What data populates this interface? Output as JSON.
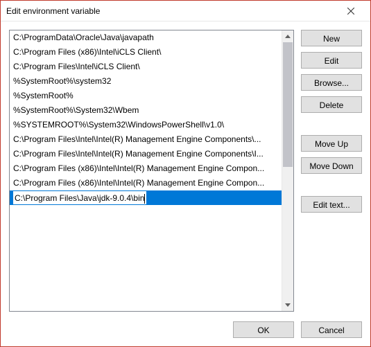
{
  "title": "Edit environment variable",
  "list": {
    "items": [
      "C:\\ProgramData\\Oracle\\Java\\javapath",
      "C:\\Program Files (x86)\\Intel\\iCLS Client\\",
      "C:\\Program Files\\Intel\\iCLS Client\\",
      "%SystemRoot%\\system32",
      "%SystemRoot%",
      "%SystemRoot%\\System32\\Wbem",
      "%SYSTEMROOT%\\System32\\WindowsPowerShell\\v1.0\\",
      "C:\\Program Files\\Intel\\Intel(R) Management Engine Components\\...",
      "C:\\Program Files\\Intel\\Intel(R) Management Engine Components\\I...",
      "C:\\Program Files (x86)\\Intel\\Intel(R) Management Engine Compon...",
      "C:\\Program Files (x86)\\Intel\\Intel(R) Management Engine Compon..."
    ],
    "editing_index": 11,
    "editing_value": "C:\\Program Files\\Java\\jdk-9.0.4\\bin"
  },
  "buttons": {
    "new": "New",
    "edit": "Edit",
    "browse": "Browse...",
    "delete": "Delete",
    "move_up": "Move Up",
    "move_down": "Move Down",
    "edit_text": "Edit text...",
    "ok": "OK",
    "cancel": "Cancel"
  }
}
